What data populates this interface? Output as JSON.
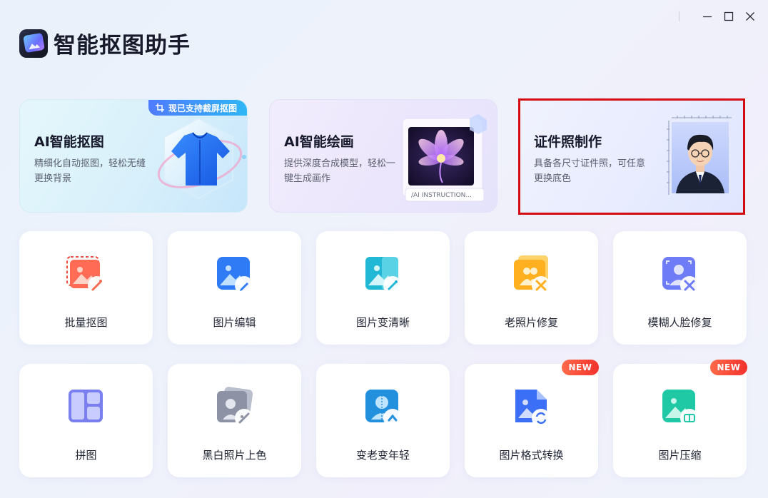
{
  "app": {
    "title": "智能抠图助手"
  },
  "window_controls": {
    "minimize": "minimize-icon",
    "maximize": "maximize-icon",
    "close": "close-icon"
  },
  "banners": [
    {
      "title": "AI智能抠图",
      "desc": "精细化自动抠图，轻松无缝更换背景",
      "badge": "现已支持截屏抠图"
    },
    {
      "title": "AI智能绘画",
      "desc": "提供深度合成模型，轻松一键生成画作",
      "art_caption": "/AI INSTRUCTION..."
    },
    {
      "title": "证件照制作",
      "desc": "具备各尺寸证件照，可任意更换底色",
      "highlight_color": "#d30c12"
    }
  ],
  "tools": [
    {
      "label": "批量抠图",
      "icon": "batch-cutout-icon"
    },
    {
      "label": "图片编辑",
      "icon": "image-edit-icon"
    },
    {
      "label": "图片变清晰",
      "icon": "image-sharpen-icon"
    },
    {
      "label": "老照片修复",
      "icon": "old-photo-repair-icon"
    },
    {
      "label": "模糊人脸修复",
      "icon": "face-repair-icon"
    },
    {
      "label": "拼图",
      "icon": "collage-icon"
    },
    {
      "label": "黑白照片上色",
      "icon": "colorize-icon"
    },
    {
      "label": "变老变年轻",
      "icon": "age-change-icon"
    },
    {
      "label": "图片格式转换",
      "icon": "format-convert-icon",
      "badge": "NEW"
    },
    {
      "label": "图片压缩",
      "icon": "compress-icon",
      "badge": "NEW"
    }
  ],
  "colors": {
    "accent": "#4f7bff",
    "new_badge": "#f2322d"
  }
}
